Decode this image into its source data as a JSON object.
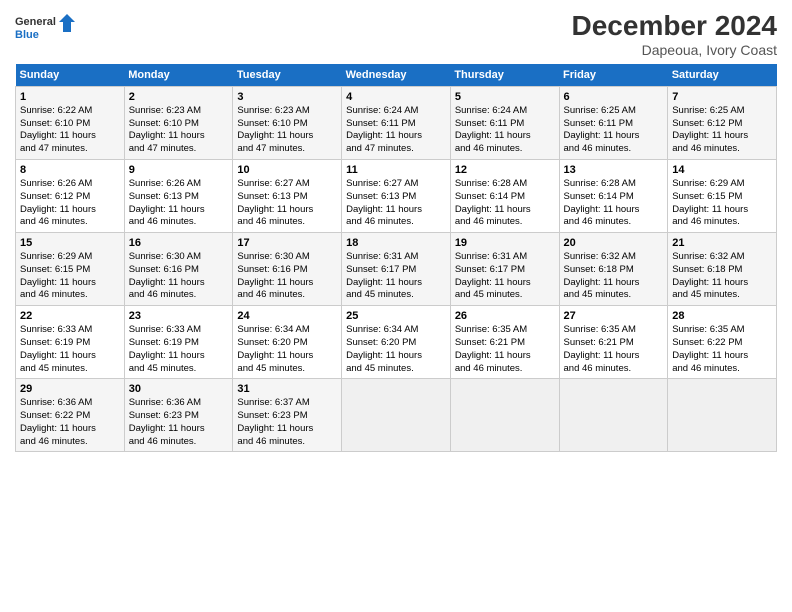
{
  "header": {
    "logo_line1": "General",
    "logo_line2": "Blue",
    "title": "December 2024",
    "subtitle": "Dapeoua, Ivory Coast"
  },
  "columns": [
    "Sunday",
    "Monday",
    "Tuesday",
    "Wednesday",
    "Thursday",
    "Friday",
    "Saturday"
  ],
  "weeks": [
    {
      "days": [
        {
          "num": "1",
          "rise": "6:22 AM",
          "set": "6:10 PM",
          "hours": "11",
          "mins": "47"
        },
        {
          "num": "2",
          "rise": "6:23 AM",
          "set": "6:10 PM",
          "hours": "11",
          "mins": "47"
        },
        {
          "num": "3",
          "rise": "6:23 AM",
          "set": "6:10 PM",
          "hours": "11",
          "mins": "47"
        },
        {
          "num": "4",
          "rise": "6:24 AM",
          "set": "6:11 PM",
          "hours": "11",
          "mins": "47"
        },
        {
          "num": "5",
          "rise": "6:24 AM",
          "set": "6:11 PM",
          "hours": "11",
          "mins": "46"
        },
        {
          "num": "6",
          "rise": "6:25 AM",
          "set": "6:11 PM",
          "hours": "11",
          "mins": "46"
        },
        {
          "num": "7",
          "rise": "6:25 AM",
          "set": "6:12 PM",
          "hours": "11",
          "mins": "46"
        }
      ]
    },
    {
      "days": [
        {
          "num": "8",
          "rise": "6:26 AM",
          "set": "6:12 PM",
          "hours": "11",
          "mins": "46"
        },
        {
          "num": "9",
          "rise": "6:26 AM",
          "set": "6:13 PM",
          "hours": "11",
          "mins": "46"
        },
        {
          "num": "10",
          "rise": "6:27 AM",
          "set": "6:13 PM",
          "hours": "11",
          "mins": "46"
        },
        {
          "num": "11",
          "rise": "6:27 AM",
          "set": "6:13 PM",
          "hours": "11",
          "mins": "46"
        },
        {
          "num": "12",
          "rise": "6:28 AM",
          "set": "6:14 PM",
          "hours": "11",
          "mins": "46"
        },
        {
          "num": "13",
          "rise": "6:28 AM",
          "set": "6:14 PM",
          "hours": "11",
          "mins": "46"
        },
        {
          "num": "14",
          "rise": "6:29 AM",
          "set": "6:15 PM",
          "hours": "11",
          "mins": "46"
        }
      ]
    },
    {
      "days": [
        {
          "num": "15",
          "rise": "6:29 AM",
          "set": "6:15 PM",
          "hours": "11",
          "mins": "46"
        },
        {
          "num": "16",
          "rise": "6:30 AM",
          "set": "6:16 PM",
          "hours": "11",
          "mins": "46"
        },
        {
          "num": "17",
          "rise": "6:30 AM",
          "set": "6:16 PM",
          "hours": "11",
          "mins": "46"
        },
        {
          "num": "18",
          "rise": "6:31 AM",
          "set": "6:17 PM",
          "hours": "11",
          "mins": "45"
        },
        {
          "num": "19",
          "rise": "6:31 AM",
          "set": "6:17 PM",
          "hours": "11",
          "mins": "45"
        },
        {
          "num": "20",
          "rise": "6:32 AM",
          "set": "6:18 PM",
          "hours": "11",
          "mins": "45"
        },
        {
          "num": "21",
          "rise": "6:32 AM",
          "set": "6:18 PM",
          "hours": "11",
          "mins": "45"
        }
      ]
    },
    {
      "days": [
        {
          "num": "22",
          "rise": "6:33 AM",
          "set": "6:19 PM",
          "hours": "11",
          "mins": "45"
        },
        {
          "num": "23",
          "rise": "6:33 AM",
          "set": "6:19 PM",
          "hours": "11",
          "mins": "45"
        },
        {
          "num": "24",
          "rise": "6:34 AM",
          "set": "6:20 PM",
          "hours": "11",
          "mins": "45"
        },
        {
          "num": "25",
          "rise": "6:34 AM",
          "set": "6:20 PM",
          "hours": "11",
          "mins": "45"
        },
        {
          "num": "26",
          "rise": "6:35 AM",
          "set": "6:21 PM",
          "hours": "11",
          "mins": "46"
        },
        {
          "num": "27",
          "rise": "6:35 AM",
          "set": "6:21 PM",
          "hours": "11",
          "mins": "46"
        },
        {
          "num": "28",
          "rise": "6:35 AM",
          "set": "6:22 PM",
          "hours": "11",
          "mins": "46"
        }
      ]
    },
    {
      "days": [
        {
          "num": "29",
          "rise": "6:36 AM",
          "set": "6:22 PM",
          "hours": "11",
          "mins": "46"
        },
        {
          "num": "30",
          "rise": "6:36 AM",
          "set": "6:23 PM",
          "hours": "11",
          "mins": "46"
        },
        {
          "num": "31",
          "rise": "6:37 AM",
          "set": "6:23 PM",
          "hours": "11",
          "mins": "46"
        },
        null,
        null,
        null,
        null
      ]
    }
  ]
}
